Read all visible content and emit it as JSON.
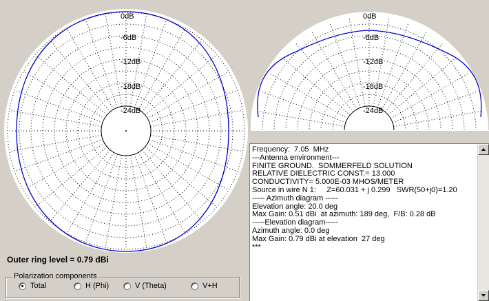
{
  "azimuth_plot": {
    "ring_labels": [
      "0dB",
      "-6dB",
      "-12dB",
      "-18dB",
      "-24dB"
    ]
  },
  "elevation_plot": {
    "ring_labels": [
      "0dB",
      "-6dB",
      "-12dB",
      "-18dB",
      "-24dB"
    ]
  },
  "outer_ring_level": "Outer ring level = 0.79 dBi",
  "polarization": {
    "title": "Polarization components",
    "options": [
      {
        "label": "Total",
        "checked": true
      },
      {
        "label": "H (Phi)",
        "checked": false
      },
      {
        "label": "V (Theta)",
        "checked": false
      },
      {
        "label": "V+H",
        "checked": false
      }
    ]
  },
  "info_lines": [
    "Frequency:  7.05  MHz",
    "---Antenna environment---",
    "FINITE GROUND.  SOMMERFELD SOLUTION",
    "RELATIVE DIELECTRIC CONST.= 13.000",
    "CONDUCTIVITY= 5.000E-03 MHOS/METER",
    "Source in wire N 1:     Z=60.031 + j 0.299   SWR(50+j0)=1.20",
    "----- Azimuth diagram -----",
    "Elevation angle: 20.0 deg",
    "Max Gain: 0.51 dBi  at azimuth: 189 deg,  F/B: 0.28 dB",
    "-----Elevation diagram-----",
    "Azimuth angle: 0.0 deg",
    "Max Gain: 0.79 dBi at elevation  27 deg",
    "***"
  ],
  "colors": {
    "pattern": "#0000cc",
    "window_bg": "#d4d0c8",
    "plot_bg": "#ffffff",
    "grid": "#000000"
  }
}
